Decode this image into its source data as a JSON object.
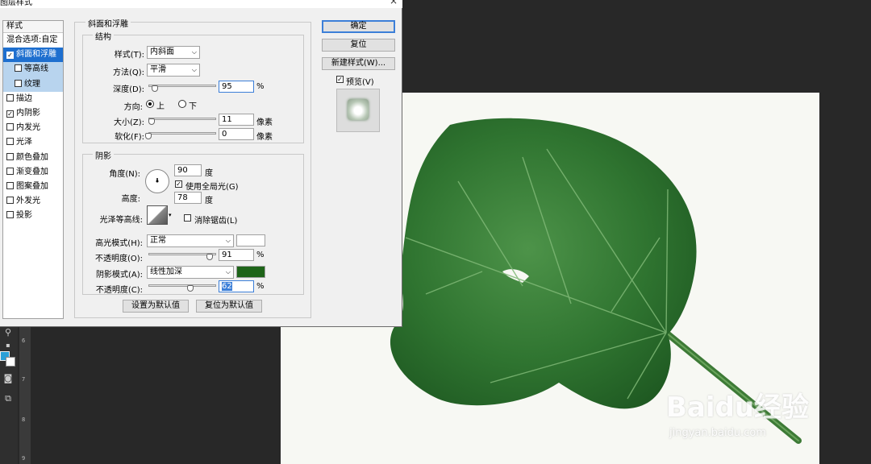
{
  "dialog": {
    "title": "图层样式",
    "close": "×"
  },
  "styles_panel": {
    "header": "样式",
    "items": [
      {
        "label": "混合选项:自定",
        "has_checkbox": false,
        "checked": false
      },
      {
        "label": "斜面和浮雕",
        "has_checkbox": true,
        "checked": true,
        "selected": true
      },
      {
        "label": "等高线",
        "has_checkbox": true,
        "checked": false,
        "sub": true
      },
      {
        "label": "纹理",
        "has_checkbox": true,
        "checked": false,
        "sub": true
      },
      {
        "label": "描边",
        "has_checkbox": true,
        "checked": false
      },
      {
        "label": "内阴影",
        "has_checkbox": true,
        "checked": true
      },
      {
        "label": "内发光",
        "has_checkbox": true,
        "checked": false
      },
      {
        "label": "光泽",
        "has_checkbox": true,
        "checked": false
      },
      {
        "label": "颜色叠加",
        "has_checkbox": true,
        "checked": false
      },
      {
        "label": "渐变叠加",
        "has_checkbox": true,
        "checked": false
      },
      {
        "label": "图案叠加",
        "has_checkbox": true,
        "checked": false
      },
      {
        "label": "外发光",
        "has_checkbox": true,
        "checked": false
      },
      {
        "label": "投影",
        "has_checkbox": true,
        "checked": false
      }
    ]
  },
  "bevel": {
    "section_title": "斜面和浮雕",
    "structure": {
      "title": "结构",
      "style_label": "样式(T):",
      "style_value": "内斜面",
      "method_label": "方法(Q):",
      "method_value": "平滑",
      "depth_label": "深度(D):",
      "depth_value": "95",
      "depth_unit": "%",
      "depth_level": 0.095,
      "direction_label": "方向:",
      "direction_up": "上",
      "direction_down": "下",
      "direction_selected": "上",
      "size_label": "大小(Z):",
      "size_value": "11",
      "size_unit": "像素",
      "size_level": 0.045,
      "soften_label": "软化(F):",
      "soften_value": "0",
      "soften_unit": "像素",
      "soften_level": 0.0
    },
    "shading": {
      "title": "阴影",
      "angle_label": "角度(N):",
      "angle_value": "90",
      "angle_unit": "度",
      "global_light_label": "使用全局光(G)",
      "global_light_checked": true,
      "altitude_label": "高度:",
      "altitude_value": "78",
      "altitude_unit": "度",
      "gloss_label": "光泽等高线:",
      "antialias_label": "消除锯齿(L)",
      "antialias_checked": false,
      "highlight_mode_label": "高光模式(H):",
      "highlight_mode_value": "正常",
      "highlight_color": "#ffffff",
      "highlight_opacity_label": "不透明度(O):",
      "highlight_opacity_value": "91",
      "highlight_opacity_unit": "%",
      "highlight_opacity_level": 0.91,
      "shadow_mode_label": "阴影模式(A):",
      "shadow_mode_value": "线性加深",
      "shadow_color": "#1e6419",
      "shadow_opacity_label": "不透明度(C):",
      "shadow_opacity_value": "62",
      "shadow_opacity_unit": "%",
      "shadow_opacity_level": 0.62
    },
    "make_default": "设置为默认值",
    "reset_default": "复位为默认值"
  },
  "side_buttons": {
    "ok": "确定",
    "reset": "复位",
    "new_style": "新建样式(W)...",
    "preview_label": "预览(V)",
    "preview_checked": true
  },
  "workspace": {
    "ruler_marks": [
      "6",
      "7",
      "8",
      "9"
    ],
    "watermark": "Baidu经验",
    "watermark_url": "jingyan.baidu.com"
  },
  "colors": {
    "selection": "#1e6fcf",
    "sub_selection": "#b8d4ee",
    "leaf_dark": "#2c6a2e",
    "leaf_light": "#4f9a4c"
  }
}
